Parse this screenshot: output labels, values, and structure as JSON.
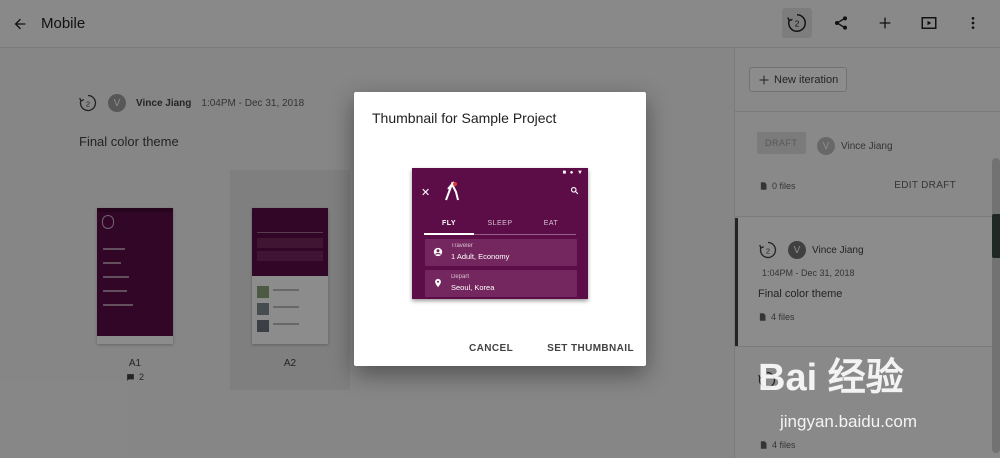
{
  "topbar": {
    "title": "Mobile",
    "iteration_count": "2"
  },
  "main": {
    "iteration_number": "2",
    "avatar_initial": "V",
    "author": "Vince Jiang",
    "timestamp": "1:04PM - Dec 31, 2018",
    "title": "Final color theme",
    "screens": [
      {
        "label": "A1",
        "comments": "2"
      },
      {
        "label": "A2"
      }
    ]
  },
  "sidepanel": {
    "new_iteration_label": "New iteration",
    "draft": {
      "badge": "DRAFT",
      "avatar_initial": "V",
      "author": "Vince Jiang",
      "files": "0 files",
      "edit_label": "EDIT DRAFT"
    },
    "iteration": {
      "number": "2",
      "avatar_initial": "V",
      "author": "Vince Jiang",
      "timestamp": "1:04PM - Dec 31, 2018",
      "title": "Final color theme",
      "files": "4 files"
    },
    "next_iteration": {
      "files": "4 files"
    }
  },
  "dialog": {
    "title": "Thumbnail for Sample Project",
    "preview": {
      "tabs": [
        "FLY",
        "SLEEP",
        "EAT"
      ],
      "active_tab": "FLY",
      "fields": [
        {
          "label": "Traveler",
          "value": "1 Adult, Economy"
        },
        {
          "label": "Depart",
          "value": "Seoul, Korea"
        }
      ]
    },
    "cancel_label": "CANCEL",
    "confirm_label": "SET THUMBNAIL"
  },
  "watermark": {
    "logo": "Bai 经验",
    "url": "jingyan.baidu.com"
  },
  "colors": {
    "brand_purple": "#5c0c47",
    "field_purple": "#74275e",
    "overlay": "rgba(0,0,0,0.45)"
  }
}
